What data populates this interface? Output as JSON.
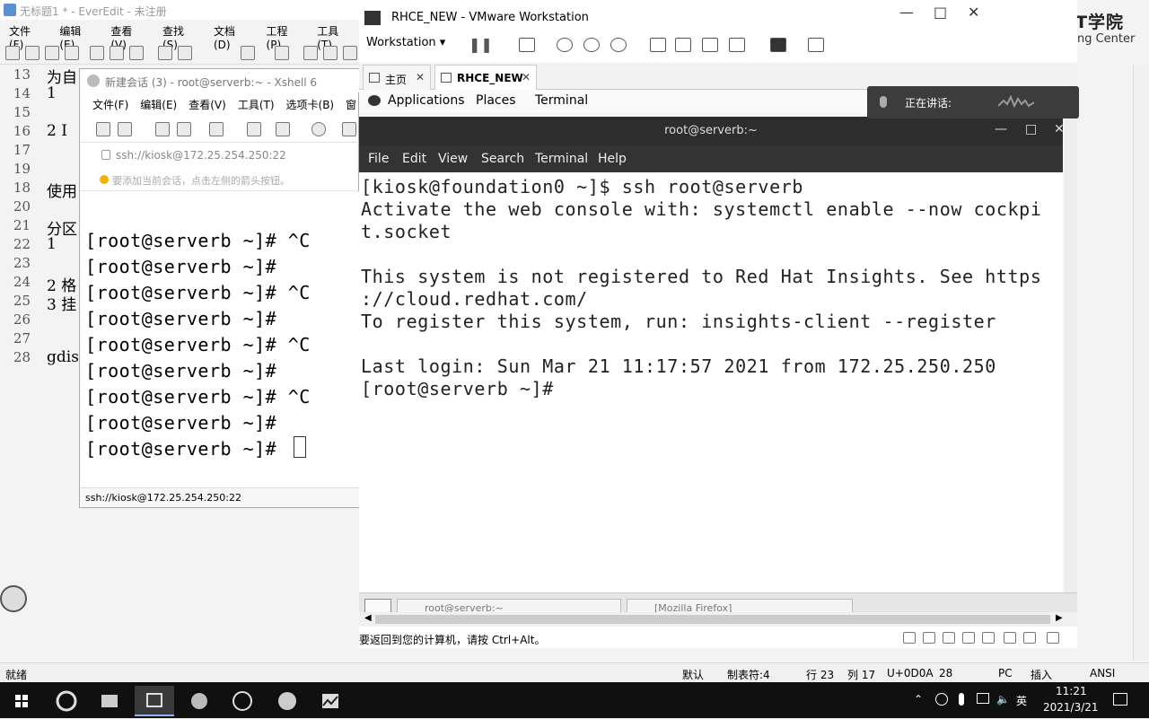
{
  "everedit": {
    "title": "无标题1 * - EverEdit - 未注册",
    "menu": [
      "文件(F)",
      "编辑(E)",
      "查看(V)",
      "查找(S)",
      "文档(D)",
      "工程(P)",
      "工具(T)"
    ],
    "line_numbers": [
      "13",
      "14",
      "15",
      "16",
      "17",
      "18",
      "19",
      "20",
      "21",
      "22",
      "23",
      "24",
      "25",
      "26",
      "27",
      "28"
    ],
    "text_lines": [
      {
        "line": "13",
        "text": "为自"
      },
      {
        "line": "14",
        "text": "1"
      },
      {
        "line": "16",
        "text": "2 I"
      },
      {
        "line": "19",
        "text": "使用"
      },
      {
        "line": "21",
        "text": "分区"
      },
      {
        "line": "22",
        "text": "1"
      },
      {
        "line": "24",
        "text": "2 格"
      },
      {
        "line": "25",
        "text": "3 挂"
      },
      {
        "line": "28",
        "text": "gdis"
      }
    ],
    "status": {
      "ready": "就绪",
      "encoding_icon": "默认",
      "tab": "制表符:4",
      "row": "行 23",
      "col": "列 17",
      "unicode": "U+0D0A",
      "num": "28",
      "pc": "PC",
      "insert": "插入",
      "ansi": "ANSI"
    }
  },
  "logo": {
    "cn": "肯耐博IT学院",
    "en": "Knb Training Center"
  },
  "xshell": {
    "title": "新建会话 (3) - root@serverb:~ - Xshell 6",
    "menu": [
      "文件(F)",
      "编辑(E)",
      "查看(V)",
      "工具(T)",
      "选项卡(B)",
      "窗"
    ],
    "address": "ssh://kiosk@172.25.254.250:22",
    "hint": "要添加当前会话，点击左侧的箭头按钮。",
    "terminal_lines": [
      "[root@serverb ~]# ^C",
      "[root@serverb ~]#",
      "[root@serverb ~]# ^C",
      "[root@serverb ~]#",
      "[root@serverb ~]# ^C",
      "[root@serverb ~]#",
      "[root@serverb ~]# ^C",
      "[root@serverb ~]#",
      "[root@serverb ~]#"
    ],
    "status": "ssh://kiosk@172.25.254.250:22"
  },
  "vmware": {
    "title": "RHCE_NEW - VMware Workstation",
    "toolbar_label": "Workstation",
    "tabs": [
      {
        "label": "主页",
        "active": false
      },
      {
        "label": "RHCE_NEW",
        "active": true
      }
    ],
    "guest": {
      "gnome_menu": [
        "Applications",
        "Places",
        "Terminal"
      ],
      "terminal_title": "root@serverb:~",
      "terminal_menu": [
        "File",
        "Edit",
        "View",
        "Search",
        "Terminal",
        "Help"
      ],
      "terminal_lines": [
        "[kiosk@foundation0 ~]$ ssh root@serverb",
        "Activate the web console with: systemctl enable --now cockpi",
        "t.socket",
        "",
        "This system is not registered to Red Hat Insights. See https",
        "://cloud.redhat.com/",
        "To register this system, run: insights-client --register",
        "",
        "Last login: Sun Mar 21 11:17:57 2021 from 172.25.250.250",
        "[root@serverb ~]#"
      ],
      "taskbar": [
        "root@serverb:~",
        "[Mozilla Firefox]"
      ]
    },
    "status_message": "要返回到您的计算机，请按 Ctrl+Alt。"
  },
  "speaking_popup": {
    "label": "正在讲话:"
  },
  "taskbar": {
    "time": "11:21",
    "date": "2021/3/21",
    "ime": "英",
    "apps": [
      "start-icon",
      "edge-icon",
      "folder-icon",
      "xshell-icon",
      "firefox-icon",
      "vmware-icon",
      "browser-icon",
      "chart-icon"
    ]
  }
}
